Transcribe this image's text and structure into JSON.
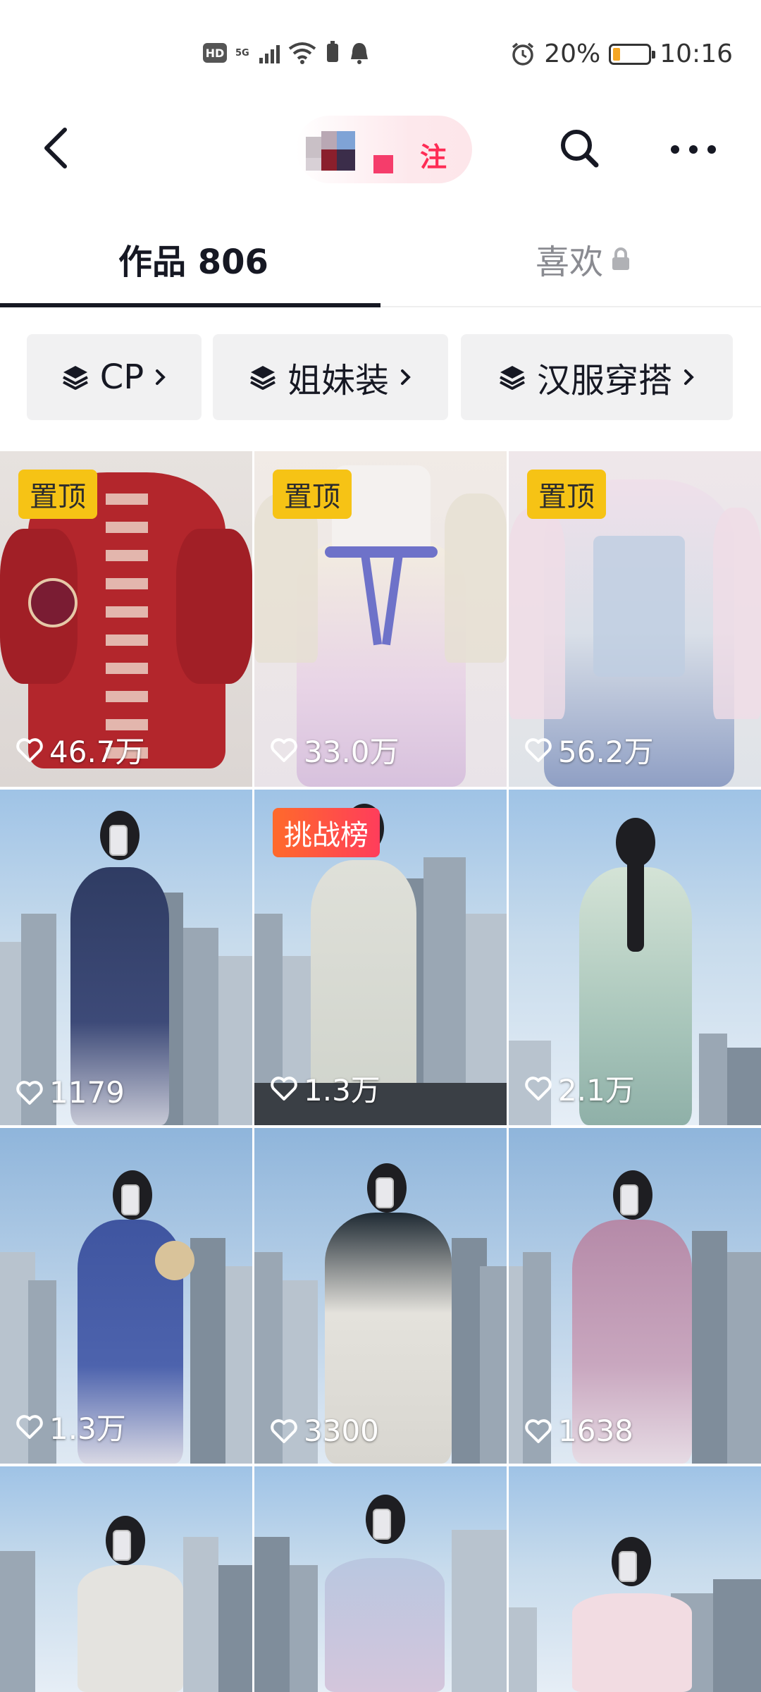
{
  "status_bar": {
    "hd": "HD",
    "network": "5G",
    "battery_percent": "20%",
    "time": "10:16",
    "battery_level": 0.2
  },
  "nav": {
    "follow_label": "注"
  },
  "tabs": {
    "works_label": "作品 806",
    "likes_label": "喜欢"
  },
  "collections": [
    {
      "label": "CP"
    },
    {
      "label": "姐妹装"
    },
    {
      "label": "汉服穿搭"
    }
  ],
  "grid": {
    "items": [
      {
        "badge": "置顶",
        "likes": "46.7万"
      },
      {
        "badge": "置顶",
        "likes": "33.0万"
      },
      {
        "badge": "置顶",
        "likes": "56.2万"
      },
      {
        "badge": "",
        "likes": "1179"
      },
      {
        "badge": "挑战榜",
        "likes": "1.3万"
      },
      {
        "badge": "",
        "likes": "2.1万"
      },
      {
        "badge": "",
        "likes": "1.3万"
      },
      {
        "badge": "",
        "likes": "3300"
      },
      {
        "badge": "",
        "likes": "1638"
      },
      {
        "badge": "",
        "likes": ""
      },
      {
        "badge": "",
        "likes": ""
      },
      {
        "badge": "",
        "likes": ""
      }
    ]
  },
  "colors": {
    "accent": "#fe2c55",
    "pinned_badge": "#f6c315",
    "challenge_badge": "#ff4d4f",
    "text_primary": "#161823",
    "text_secondary": "#8a8b91"
  }
}
